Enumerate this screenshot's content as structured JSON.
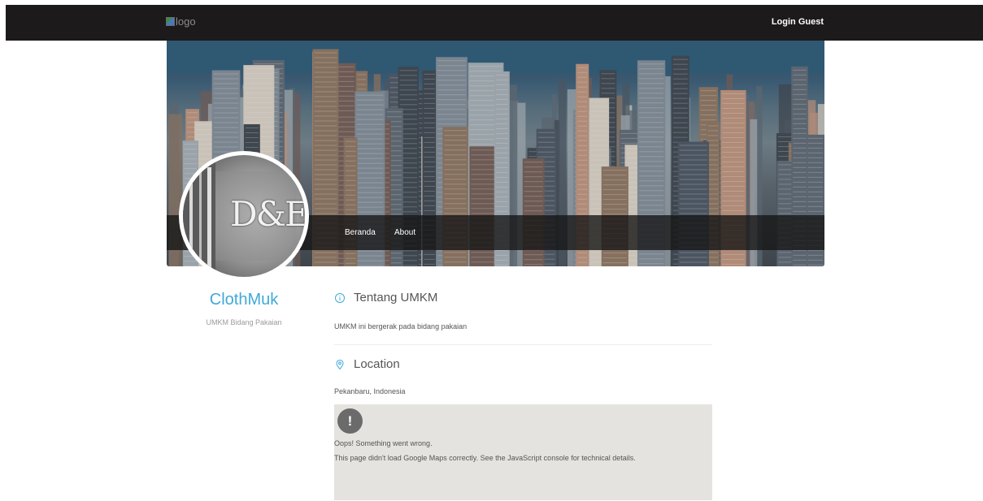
{
  "navbar": {
    "logo_alt": "logo",
    "login_label": "Login Guest"
  },
  "hero": {
    "nav": [
      {
        "label": "Beranda"
      },
      {
        "label": "About"
      }
    ],
    "avatar_text": "D&E"
  },
  "profile": {
    "name": "ClothMuk",
    "subtitle": "UMKM Bidang Pakaian"
  },
  "about": {
    "icon": "info-circle-icon",
    "title": "Tentang UMKM",
    "text": "UMKM ini bergerak pada bidang pakaian"
  },
  "location": {
    "icon": "map-marker-icon",
    "title": "Location",
    "text": "Pekanbaru, Indonesia"
  },
  "map": {
    "error_title": "Oops! Something went wrong.",
    "error_detail": "This page didn't load Google Maps correctly. See the JavaScript console for technical details."
  },
  "colors": {
    "navbar_bg": "#1c1a1a",
    "accent": "#3fa9d9",
    "map_bg": "#e5e3df"
  }
}
